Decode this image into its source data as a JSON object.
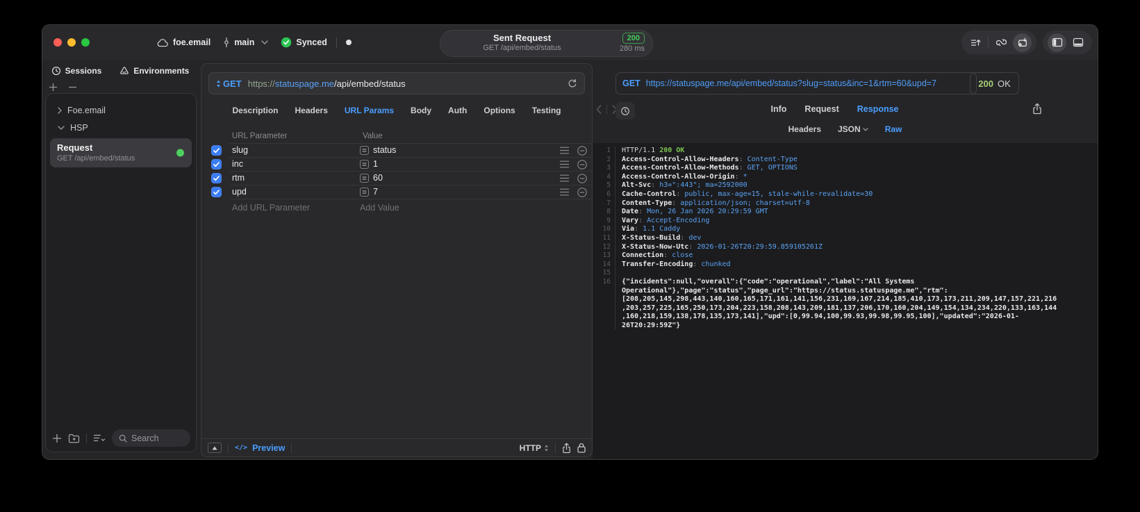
{
  "titlebar": {
    "project": "foe.email",
    "branch": "main",
    "sync_label": "Synced",
    "request_title": "Sent Request",
    "request_subtitle": "GET /api/embed/status",
    "status_code": "200",
    "duration": "280 ms"
  },
  "sidebar": {
    "tab_sessions": "Sessions",
    "tab_environments": "Environments",
    "group_collapsed": "Foe.email",
    "group_expanded": "HSP",
    "request_title": "Request",
    "request_subtitle": "GET /api/embed/status",
    "search_placeholder": "Search"
  },
  "request_editor": {
    "method": "GET",
    "url_scheme": "https://",
    "url_host": "statuspage.me",
    "url_path": "/api/embed/status",
    "tabs": [
      "Description",
      "Headers",
      "URL Params",
      "Body",
      "Auth",
      "Options",
      "Testing"
    ],
    "active_tab": "URL Params",
    "param_col_name": "URL Parameter",
    "param_col_value": "Value",
    "params": [
      {
        "name": "slug",
        "value": "status",
        "checked": true
      },
      {
        "name": "inc",
        "value": "1",
        "checked": true
      },
      {
        "name": "rtm",
        "value": "60",
        "checked": true
      },
      {
        "name": "upd",
        "value": "7",
        "checked": true
      }
    ],
    "add_param_label": "Add URL Parameter",
    "add_value_label": "Add Value",
    "preview_icon": "</>",
    "preview_label": "Preview",
    "protocol_label": "HTTP"
  },
  "response_viewer": {
    "method": "GET",
    "url": "https://statuspage.me/api/embed/status?slug=status&inc=1&rtm=60&upd=7",
    "status_code": "200",
    "status_text": "OK",
    "tabs": [
      "Info",
      "Request",
      "Response"
    ],
    "active_tab": "Response",
    "subtabs": [
      "Headers",
      "JSON",
      "Raw"
    ],
    "active_subtab": "Raw",
    "status_line_protocol": "HTTP/1.1",
    "status_line_status": "200 OK",
    "headers": [
      {
        "name": "Access-Control-Allow-Headers",
        "value": "Content-Type"
      },
      {
        "name": "Access-Control-Allow-Methods",
        "value": "GET, OPTIONS"
      },
      {
        "name": "Access-Control-Allow-Origin",
        "value": "*"
      },
      {
        "name": "Alt-Svc",
        "value": "h3=\":443\"; ma=2592000"
      },
      {
        "name": "Cache-Control",
        "value": "public, max-age=15, stale-while-revalidate=30"
      },
      {
        "name": "Content-Type",
        "value": "application/json; charset=utf-8"
      },
      {
        "name": "Date",
        "value": "Mon, 26 Jan 2026 20:29:59 GMT"
      },
      {
        "name": "Vary",
        "value": "Accept-Encoding"
      },
      {
        "name": "Via",
        "value": "1.1 Caddy"
      },
      {
        "name": "X-Status-Build",
        "value": "dev"
      },
      {
        "name": "X-Status-Now-Utc",
        "value": "2026-01-26T20:29:59.859105261Z"
      },
      {
        "name": "Connection",
        "value": "close"
      },
      {
        "name": "Transfer-Encoding",
        "value": "chunked"
      }
    ],
    "body": "{\"incidents\":null,\"overall\":{\"code\":\"operational\",\"label\":\"All Systems Operational\"},\"page\":\"status\",\"page_url\":\"https://status.statuspage.me\",\"rtm\":[208,205,145,298,443,140,160,165,171,161,141,156,231,169,167,214,185,410,173,173,211,209,147,157,221,216,203,257,225,165,250,173,204,223,158,208,143,209,181,137,206,170,160,204,149,154,134,234,220,133,163,144,160,218,159,138,178,135,173,141],\"upd\":[0,99.94,100,99.93,99.98,99.95,100],\"updated\":\"2026-01-26T20:29:59Z\"}"
  },
  "icons": {
    "cloud-icon": "cloud outline",
    "branch-icon": "git commit line-dot",
    "sync-check-icon": "green circle check",
    "history-clock-icon": "clock",
    "environments-icon": "triangle prism",
    "search-icon": "magnifier",
    "equals-icon": "boxed equals",
    "row-menu-icon": "hamburger lines",
    "row-delete-icon": "circle minus",
    "share-icon": "box with up arrow",
    "lock-icon": "padlock"
  },
  "colors": {
    "accent_blue": "#4b9eff",
    "badge_green": "#43d15b",
    "code_green": "#7cc24f",
    "code_value_blue": "#5ba2f3",
    "checkbox_blue": "#3b7df5",
    "traffic_red": "#ff5f57",
    "traffic_yellow": "#febc2e",
    "traffic_green": "#28c840"
  }
}
